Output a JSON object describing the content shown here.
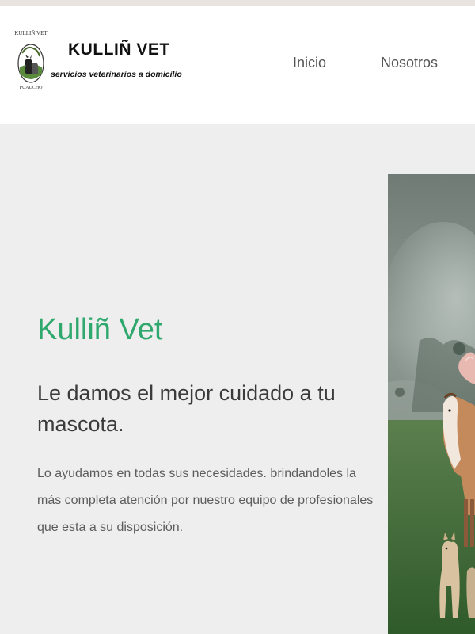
{
  "header": {
    "logo": {
      "emblem_top": "KULLIÑ VET",
      "emblem_bottom": "PUAUCHO",
      "name": "KULLIÑ VET",
      "tagline": "servicios veterinarios a domicilio"
    },
    "nav": [
      {
        "label": "Inicio"
      },
      {
        "label": "Nosotros"
      }
    ]
  },
  "hero": {
    "title": "Kulliñ Vet",
    "subtitle": "Le damos el mejor cuidado a tu mascota.",
    "description": "Lo ayudamos en todas sus necesidades. brindandoles la más completa atención por nuestro equipo de profesionales que esta a su disposición."
  },
  "colors": {
    "accent": "#2fa86e",
    "background": "#eeeeee",
    "header_bg": "#ffffff"
  }
}
